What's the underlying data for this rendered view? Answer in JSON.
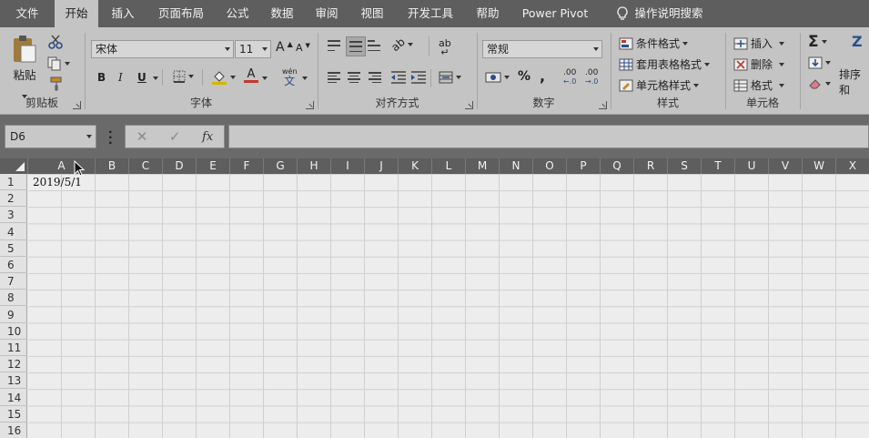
{
  "tabs": [
    "文件",
    "开始",
    "插入",
    "页面布局",
    "公式",
    "数据",
    "审阅",
    "视图",
    "开发工具",
    "帮助",
    "Power Pivot"
  ],
  "active_tab": "开始",
  "tell_me": "操作说明搜索",
  "clipboard": {
    "paste": "粘贴",
    "label": "剪贴板"
  },
  "font": {
    "name": "宋体",
    "size": "11",
    "bold": "B",
    "italic": "I",
    "underline": "U",
    "wen": "wén",
    "wen_char": "文",
    "grow": "A",
    "shrink": "A",
    "font_color": "A",
    "label": "字体"
  },
  "alignment": {
    "label": "对齐方式",
    "wrap": "ab",
    "orient": "ab"
  },
  "number": {
    "format": "常规",
    "percent": "%",
    "comma": ",",
    "inc_decimal": ".00",
    "dec_decimal": ".00",
    "label": "数字"
  },
  "styles": {
    "cond_format": "条件格式",
    "table_format": "套用表格格式",
    "cell_styles": "单元格样式",
    "label": "样式"
  },
  "cells": {
    "insert": "插入",
    "delete": "删除",
    "format": "格式",
    "label": "单元格"
  },
  "editing": {
    "sum": "Σ",
    "sort": "排序和",
    "sort_icon": "Z"
  },
  "formula_bar": {
    "name_box": "D6",
    "cancel": "✕",
    "enter": "✓",
    "fx": "fx",
    "value": ""
  },
  "columns": [
    "A",
    "B",
    "C",
    "D",
    "E",
    "F",
    "G",
    "H",
    "I",
    "J",
    "K",
    "L",
    "M",
    "N",
    "O",
    "P",
    "Q",
    "R",
    "S",
    "T",
    "U",
    "V",
    "W",
    "X"
  ],
  "rows": [
    "1",
    "2",
    "3",
    "4",
    "5",
    "6",
    "7",
    "8",
    "9",
    "10",
    "11",
    "12",
    "13",
    "14",
    "15",
    "16"
  ],
  "cell_a1": "2019/5/1"
}
